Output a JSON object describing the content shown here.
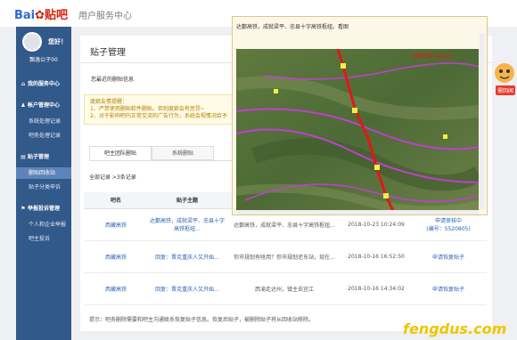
{
  "header": {
    "logo": "Bai",
    "logo_brand": "贴吧",
    "title": "用户服务中心"
  },
  "user": {
    "greeting": "您好！",
    "name": "飘逸公子00"
  },
  "sidebar": {
    "sections": [
      {
        "label": "我的服务中心",
        "icon": "home-icon"
      },
      {
        "label": "帐户管理中心",
        "icon": "user-icon"
      },
      {
        "label": "贴子管理",
        "icon": "doc-icon"
      },
      {
        "label": "举报投诉管理",
        "icon": "flag-icon"
      }
    ],
    "items": [
      "系统处理记录",
      "吧务处理记录",
      "删贴回收站",
      "贴子分类申诉",
      "个人和企业举报",
      "吧主投诉"
    ]
  },
  "page": {
    "title": "贴子管理",
    "filter": "您最近的删贴信息"
  },
  "notice": {
    "title": "度娘友情提醒：",
    "line1": "1、严禁使用删贴软件删贴，否则度娘会有惩罚~",
    "line2": "2、对于影响吧内正常交流的广告行为，系统会视情况给予"
  },
  "tabs": [
    "吧主团队删贴",
    "系统删贴"
  ],
  "records": {
    "count": "全部记录 >3条记录"
  },
  "table": {
    "headers": [
      "吧名",
      "贴子主题",
      "",
      "",
      "操作"
    ],
    "rows": [
      {
        "bar": "西藏高铁",
        "topic": "达鄞高铁，成就梁平、忠县十字高铁枢纽...",
        "reply": "达鄞高铁，成就梁平、忠县十字高铁枢纽...",
        "time": "2018-10-23 10:24:09",
        "action": "申请审核中",
        "action2": "(编号：5520805)"
      },
      {
        "bar": "西藏高铁",
        "topic": "回复：晋克重庆人又开始...",
        "reply": "你市规划有啥用？你市规划还东站，现在...",
        "time": "2018-10-16 16:52:50",
        "action": "申请恢复贴子",
        "action2": ""
      },
      {
        "bar": "西藏高铁",
        "topic": "回复：晋克重庆人又开始...",
        "reply": "西渝走达州，镇主去宜江",
        "time": "2018-10-16 14:34:02",
        "action": "申请恢复贴子",
        "action2": ""
      }
    ]
  },
  "tip": "提示：吧务删除需要和吧主沟通联系恢复贴子信息。恢复后贴子，被删除贴子将从回收站移除。",
  "popup": {
    "title": "达鄞高铁，成就梁平、忠县十字高铁枢纽。看图",
    "map_label": "达鄞高铁 600km"
  },
  "mascot": {
    "sticker": "需回闻"
  },
  "watermark": "fengdus.com",
  "colors": {
    "sidebar": "#31598a",
    "link": "#2a64b3",
    "accent": "#d81e06"
  }
}
